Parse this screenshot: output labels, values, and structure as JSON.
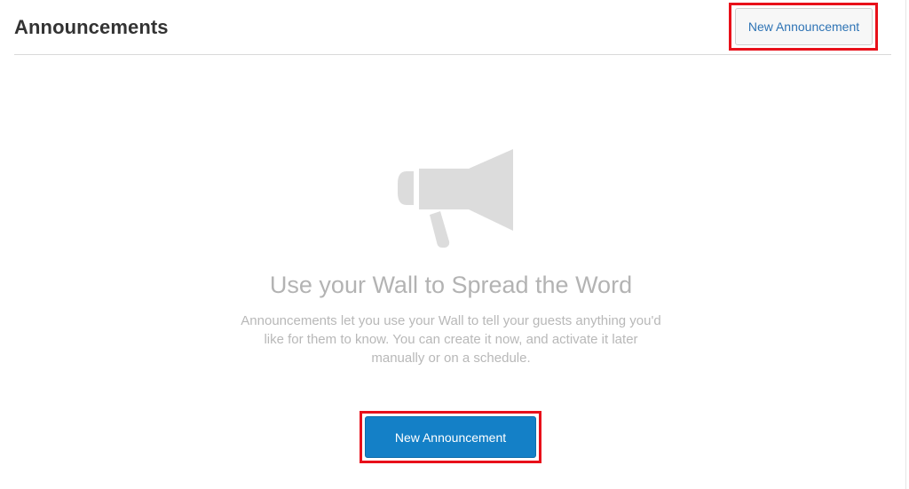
{
  "header": {
    "title": "Announcements",
    "new_button_label": "New Announcement"
  },
  "empty_state": {
    "icon": "megaphone-icon",
    "title": "Use your Wall to Spread the Word",
    "description": "Announcements let you use your Wall to tell your guests anything you'd like for them to know. You can create it now, and activate it later manually or on a schedule.",
    "button_label": "New Announcement"
  },
  "colors": {
    "primary_button": "#1480c7",
    "link_text": "#2f74b5",
    "highlight_box": "#e8101a",
    "muted_text": "#b3b3b3",
    "icon_gray": "#dcdcdc"
  }
}
